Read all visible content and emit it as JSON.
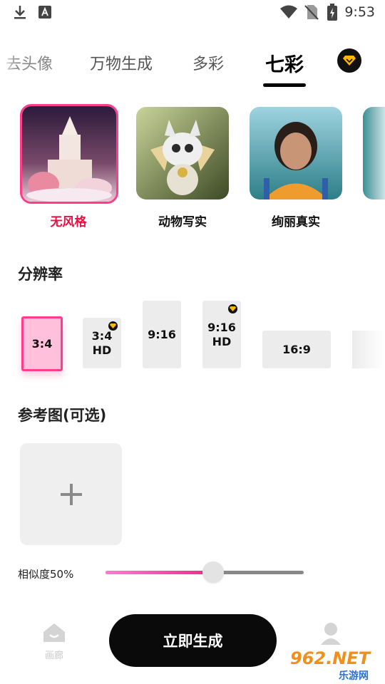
{
  "status_bar": {
    "time": "9:53"
  },
  "tabs": [
    {
      "label": "去头像",
      "active": false
    },
    {
      "label": "万物生成",
      "active": false
    },
    {
      "label": "多彩",
      "active": false
    },
    {
      "label": "七彩",
      "active": true
    }
  ],
  "styles": [
    {
      "label": "无风格",
      "selected": true
    },
    {
      "label": "动物写实",
      "selected": false
    },
    {
      "label": "绚丽真实",
      "selected": false
    }
  ],
  "resolution": {
    "title": "分辨率",
    "options": [
      {
        "label": "3:4",
        "hd": "",
        "selected": true,
        "vip": false
      },
      {
        "label": "3:4",
        "hd": "HD",
        "selected": false,
        "vip": true
      },
      {
        "label": "9:16",
        "hd": "",
        "selected": false,
        "vip": false
      },
      {
        "label": "9:16",
        "hd": "HD",
        "selected": false,
        "vip": true
      },
      {
        "label": "16:9",
        "hd": "",
        "selected": false,
        "vip": false
      }
    ]
  },
  "reference": {
    "title": "参考图(可选)"
  },
  "similarity": {
    "label": "相似度50%",
    "value": 0.5
  },
  "bottom_nav": {
    "gallery_label": "画廊",
    "generate_label": "立即生成"
  },
  "watermark": {
    "brand": "962.NET",
    "sub": "乐游网"
  },
  "colors": {
    "accent": "#ff3d8b",
    "selected_text": "#e81040",
    "vip": "#ffb800"
  }
}
